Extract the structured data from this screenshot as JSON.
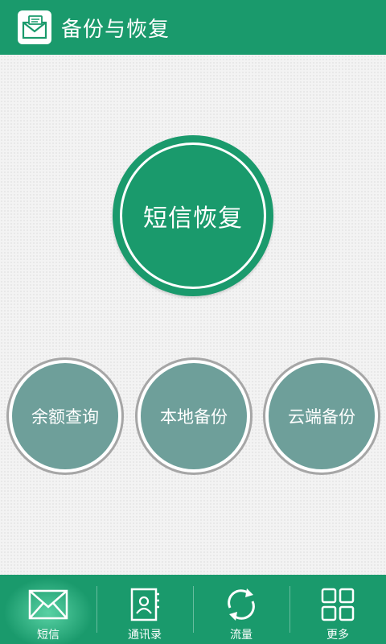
{
  "app": {
    "title": "备份与恢复",
    "icon": "sms-envelope-icon"
  },
  "main_action": {
    "label": "短信恢复"
  },
  "secondary_actions": [
    {
      "label": "余额查询"
    },
    {
      "label": "本地备份"
    },
    {
      "label": "云端备份"
    }
  ],
  "bottom_nav": [
    {
      "label": "短信",
      "icon": "envelope-icon",
      "active": true
    },
    {
      "label": "通讯录",
      "icon": "contacts-book-icon",
      "active": false
    },
    {
      "label": "流量",
      "icon": "refresh-icon",
      "active": false
    },
    {
      "label": "更多",
      "icon": "grid-icon",
      "active": false
    }
  ],
  "colors": {
    "primary": "#1a9a6c",
    "secondary_button": "#6e9f9a",
    "background": "#f3f3f3"
  }
}
